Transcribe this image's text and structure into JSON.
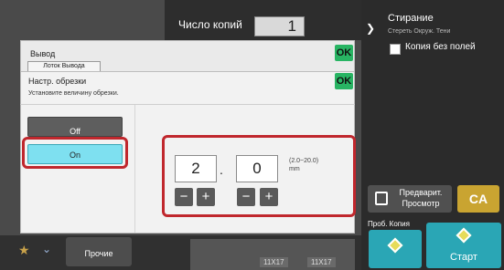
{
  "copies": {
    "label": "Число копий",
    "value": "1"
  },
  "erase": {
    "title": "Стирание",
    "subtitle": "Стереть Окруж. Тени"
  },
  "no_border_copy": {
    "label": "Копия без полей",
    "checked": false
  },
  "output_dialog": {
    "title": "Вывод",
    "tray_tab": "Лоток Вывода",
    "ok": "OK"
  },
  "trim_dialog": {
    "title": "Настр. обрезки",
    "instruction": "Установите величину обрезки.",
    "ok": "OK",
    "off_label": "Off",
    "on_label": "On",
    "selected": "On",
    "integer_value": "2",
    "decimal_separator": ".",
    "decimal_value": "0",
    "range_hint": "(2.0~20.0)",
    "unit": "mm",
    "minus": "−",
    "plus": "+"
  },
  "preview": {
    "label_line1": "Предварит.",
    "label_line2": "Просмотр"
  },
  "clear_all": {
    "label": "CA"
  },
  "proof_copy": {
    "label": "Проб. Копия"
  },
  "start": {
    "label": "Старт"
  },
  "bottom_bar": {
    "more_label": "Прочие",
    "tray_labels": [
      "11X17",
      "11X17"
    ]
  },
  "colors": {
    "ok_green": "#28b463",
    "on_cyan": "#7ee0f0",
    "highlight_red": "#c0272d",
    "start_teal": "#2aa6b5",
    "ca_gold": "#c9a431"
  }
}
